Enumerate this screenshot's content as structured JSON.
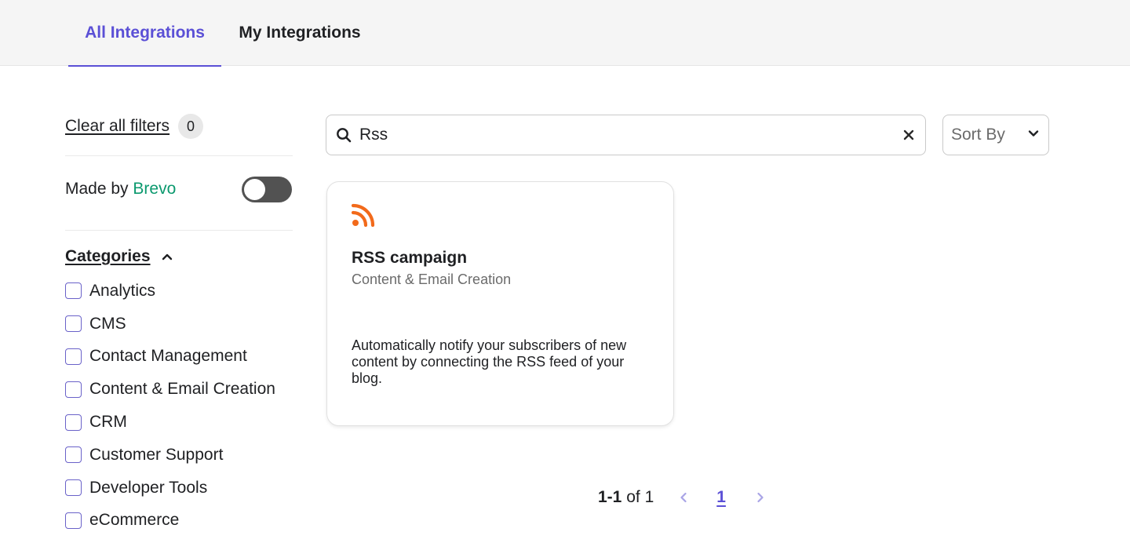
{
  "tabs": [
    {
      "label": "All Integrations",
      "active": true
    },
    {
      "label": "My Integrations",
      "active": false
    }
  ],
  "sidebar": {
    "clear_filters_label": "Clear all filters",
    "filter_count": "0",
    "made_by_label": "Made by",
    "made_by_brand": "Brevo",
    "made_by_toggle_on": false,
    "categories_title": "Categories",
    "categories": [
      {
        "label": "Analytics",
        "checked": false
      },
      {
        "label": "CMS",
        "checked": false
      },
      {
        "label": "Contact Management",
        "checked": false
      },
      {
        "label": "Content & Email Creation",
        "checked": false
      },
      {
        "label": "CRM",
        "checked": false
      },
      {
        "label": "Customer Support",
        "checked": false
      },
      {
        "label": "Developer Tools",
        "checked": false
      },
      {
        "label": "eCommerce",
        "checked": false
      }
    ]
  },
  "search": {
    "value": "Rss",
    "icon": "search-icon",
    "clear_icon": "close-icon"
  },
  "sort": {
    "label": "Sort By",
    "icon": "chevron-down-icon"
  },
  "results": [
    {
      "icon": "rss-icon",
      "title": "RSS campaign",
      "category": "Content & Email Creation",
      "description": "Automatically notify your subscribers of new content by connecting the RSS feed of your blog."
    }
  ],
  "pagination": {
    "range": "1-1",
    "of_label": "of",
    "total": "1",
    "current_page": "1"
  },
  "colors": {
    "accent": "#5b50d6",
    "brand": "#0b996e",
    "rss": "#f26a1b",
    "toggle_off": "#525252"
  }
}
